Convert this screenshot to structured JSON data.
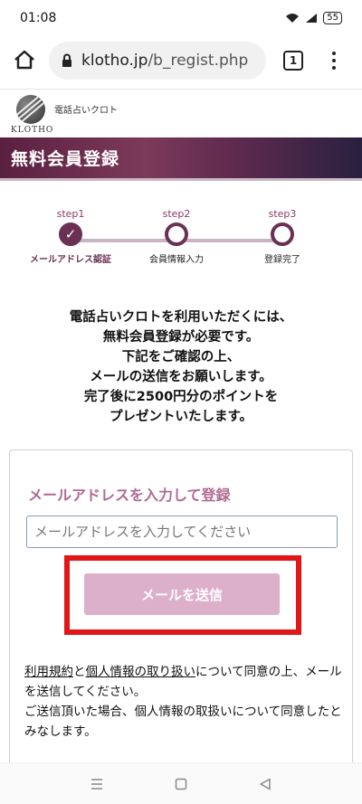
{
  "status": {
    "time": "01:08",
    "battery": "55"
  },
  "browser": {
    "url_domain": "klotho.jp",
    "url_path": "/b_regist.php",
    "tab_count": "1"
  },
  "site": {
    "logo_text": "KLOTHO",
    "tagline": "電話占いクロト"
  },
  "page_title": "無料会員登録",
  "steps": [
    {
      "num": "step1",
      "label": "メールアドレス認証",
      "state": "done"
    },
    {
      "num": "step2",
      "label": "会員情報入力",
      "state": "pending"
    },
    {
      "num": "step3",
      "label": "登録完了",
      "state": "pending"
    }
  ],
  "intro_lines": [
    "電話占いクロトを利用いただくには、",
    "無料会員登録が必要です。",
    "下記をご確認の上、",
    "メールの送信をお願いします。",
    "完了後に2500円分のポイントを",
    "プレゼントいたします。"
  ],
  "form": {
    "heading": "メールアドレスを入力して登録",
    "email_placeholder": "メールアドレスを入力してください",
    "email_value": "",
    "submit_label": "メールを送信"
  },
  "terms": {
    "link_terms": "利用規約",
    "and": "と",
    "link_privacy": "個人情報の取り扱い",
    "text1": "について同意の上、メールを送信してください。",
    "text2": "ご送信頂いた場合、個人情報の取扱いについて同意したとみなします。"
  },
  "colors": {
    "accent": "#6b3055",
    "heading": "#b06a94",
    "button": "#dcb0cb",
    "highlight": "#e21616"
  },
  "icons": [
    "wifi-icon",
    "signal-icon",
    "battery-icon",
    "home-icon",
    "lock-icon",
    "tabs-icon",
    "more-vert-icon",
    "check-icon",
    "recents-icon",
    "home-nav-icon",
    "back-icon"
  ]
}
